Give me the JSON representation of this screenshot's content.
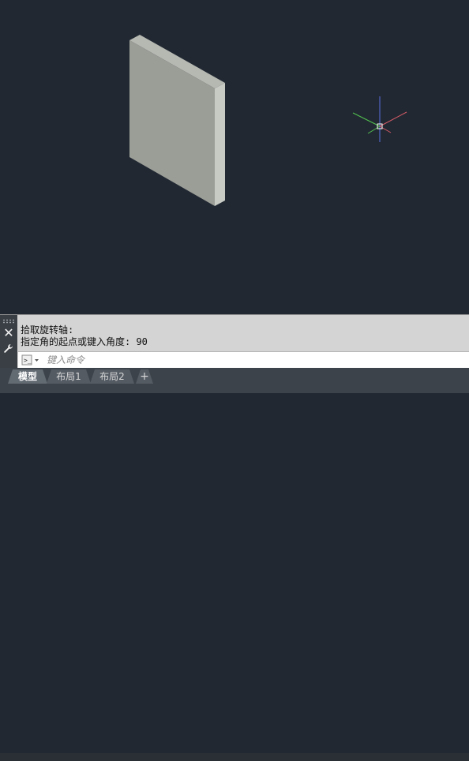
{
  "command_line": {
    "history": [
      "拾取旋转轴:",
      "指定角的起点或键入角度: 90"
    ],
    "input_placeholder": "键入命令",
    "input_value": "",
    "close_glyph": "✕",
    "settings_glyph": "🔧"
  },
  "layout_tabs": [
    {
      "label": "模型",
      "active": true
    },
    {
      "label": "布局1",
      "active": false
    },
    {
      "label": "布局2",
      "active": false
    }
  ],
  "add_tab_label": "+",
  "colors": {
    "canvas_background": "#212832",
    "solid_front": "#9b9e97",
    "solid_top": "#b6b9b2",
    "solid_side": "#c8cbc4",
    "ucs_x_axis": "#d45b66",
    "ucs_y_axis": "#53c24f",
    "ucs_z_axis": "#5b6ee0"
  }
}
